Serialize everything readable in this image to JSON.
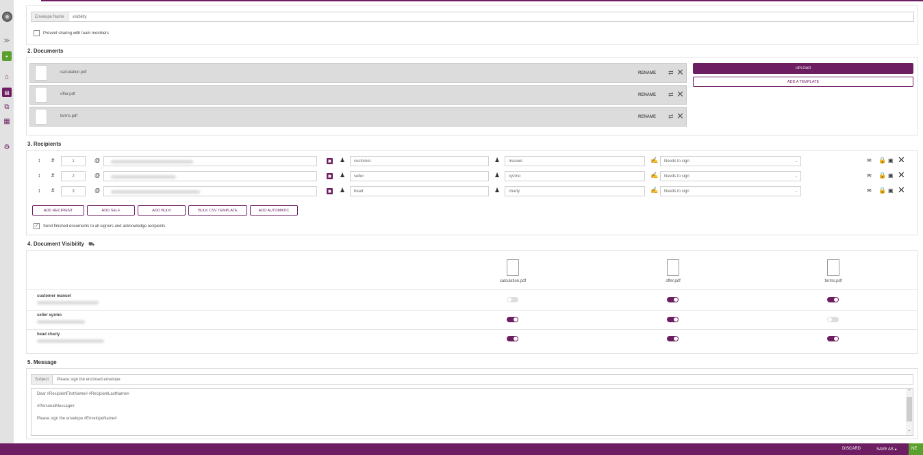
{
  "sidebar": {
    "icons": [
      "logo-icon",
      "expand-icon",
      "new-document-icon",
      "home-icon",
      "documents-icon",
      "copy-icon",
      "templates-icon",
      "settings-icon"
    ]
  },
  "envelope": {
    "name_label": "Envelope Name",
    "name_value": "visibility",
    "prevent_sharing_label": "Prevent sharing with team members"
  },
  "documents": {
    "title": "2. Documents",
    "items": [
      {
        "name": "calculation.pdf"
      },
      {
        "name": "offer.pdf"
      },
      {
        "name": "terms.pdf"
      }
    ],
    "rename_label": "RENAME",
    "upload_label": "UPLOAD",
    "add_template_label": "ADD A TEMPLATE"
  },
  "recipients": {
    "title": "3. Recipients",
    "rows": [
      {
        "order": "1",
        "first": "customer",
        "last": "manuel",
        "action": "Needs to sign"
      },
      {
        "order": "2",
        "first": "seller",
        "last": "xyzmo",
        "action": "Needs to sign"
      },
      {
        "order": "3",
        "first": "head",
        "last": "charly",
        "action": "Needs to sign"
      }
    ],
    "buttons": [
      "ADD RECIPIENT",
      "ADD SELF",
      "ADD BULK",
      "BULK CSV TEMPLATE",
      "ADD AUTOMATIC"
    ],
    "send_finished_label": "Send finished documents to all signers and acknowledge recipients"
  },
  "visibility": {
    "title": "4. Document Visibility",
    "documents": [
      "calculation.pdf",
      "offer.pdf",
      "terms.pdf"
    ],
    "rows": [
      {
        "name": "customer manuel",
        "toggles": [
          false,
          true,
          true
        ]
      },
      {
        "name": "seller xyzmo",
        "toggles": [
          true,
          true,
          false
        ]
      },
      {
        "name": "head charly",
        "toggles": [
          true,
          true,
          true
        ]
      }
    ]
  },
  "message": {
    "title": "5. Message",
    "subject_label": "Subject",
    "subject_value": "Please sign the enclosed envelope",
    "body_line1": "Dear #RecipientFirstName# #RecipientLastName#",
    "body_line2": "#PersonalMessage#",
    "body_line3": "Please sign the envelope #EnvelopeName#"
  },
  "footer": {
    "discard_label": "DISCARD",
    "save_as_label": "SAVE AS",
    "next_label": "NE"
  },
  "colors": {
    "accent": "#6d1e63",
    "next_green": "#5aa02c"
  }
}
